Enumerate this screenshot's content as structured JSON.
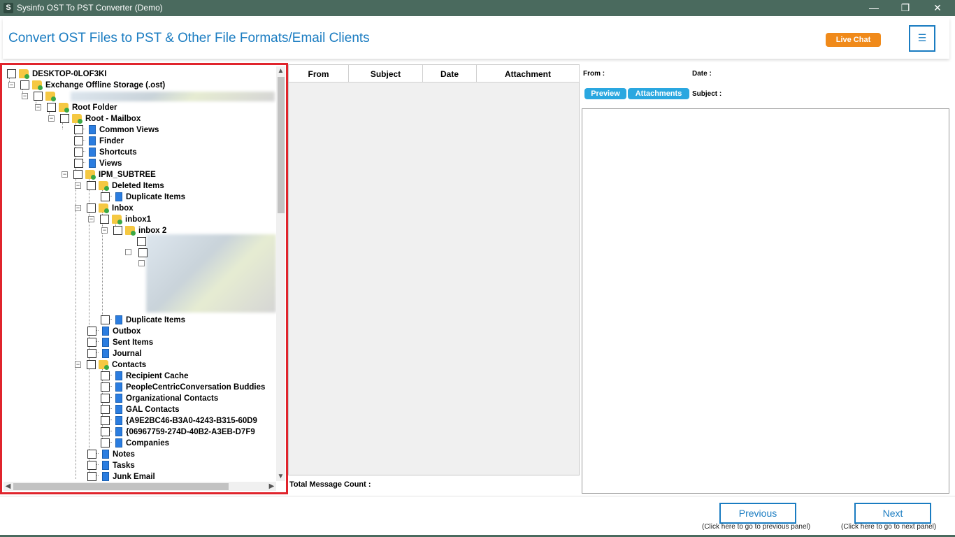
{
  "window": {
    "app_icon_letter": "S",
    "title": "Sysinfo OST To PST Converter (Demo)",
    "minimize": "—",
    "restore": "❐",
    "close": "✕"
  },
  "header": {
    "title": "Convert OST Files to PST & Other File Formats/Email Clients",
    "live_chat": "Live Chat",
    "menu_icon": "☰"
  },
  "tree": {
    "expander": "−",
    "nodes": [
      {
        "label": "DESKTOP-0LOF3KI",
        "icon": "folder-icon"
      },
      {
        "label": "Exchange Offline Storage (.ost)",
        "icon": "folder-icon"
      },
      {
        "label": "",
        "icon": "folder-icon"
      },
      {
        "label": "Root Folder",
        "icon": "folder-icon"
      },
      {
        "label": "Root - Mailbox",
        "icon": "folder-icon"
      },
      {
        "label": "Common Views",
        "icon": "doc-icon"
      },
      {
        "label": "Finder",
        "icon": "doc-icon"
      },
      {
        "label": "Shortcuts",
        "icon": "doc-icon"
      },
      {
        "label": "Views",
        "icon": "doc-icon"
      },
      {
        "label": "IPM_SUBTREE",
        "icon": "folder-icon"
      },
      {
        "label": "Deleted Items",
        "icon": "folder-icon"
      },
      {
        "label": "Duplicate Items",
        "icon": "doc-icon"
      },
      {
        "label": "Inbox",
        "icon": "folder-icon"
      },
      {
        "label": "inbox1",
        "icon": "folder-icon"
      },
      {
        "label": "inbox 2",
        "icon": "folder-icon"
      },
      {
        "label": "Duplicate Items",
        "icon": "doc-icon"
      },
      {
        "label": "Outbox",
        "icon": "doc-icon"
      },
      {
        "label": "Sent Items",
        "icon": "doc-icon"
      },
      {
        "label": "Journal",
        "icon": "doc-icon"
      },
      {
        "label": "Contacts",
        "icon": "folder-icon"
      },
      {
        "label": "Recipient Cache",
        "icon": "doc-icon"
      },
      {
        "label": "PeopleCentricConversation Buddies",
        "icon": "doc-icon"
      },
      {
        "label": "Organizational Contacts",
        "icon": "doc-icon"
      },
      {
        "label": "GAL Contacts",
        "icon": "doc-icon"
      },
      {
        "label": "{A9E2BC46-B3A0-4243-B315-60D9",
        "icon": "doc-icon"
      },
      {
        "label": "{06967759-274D-40B2-A3EB-D7F9",
        "icon": "doc-icon"
      },
      {
        "label": "Companies",
        "icon": "doc-icon"
      },
      {
        "label": "Notes",
        "icon": "doc-icon"
      },
      {
        "label": "Tasks",
        "icon": "doc-icon"
      },
      {
        "label": "Junk Email",
        "icon": "doc-icon"
      }
    ],
    "scroll_up": "▲",
    "scroll_down": "▼",
    "scroll_left": "◀",
    "scroll_right": "▶"
  },
  "message_list": {
    "columns": [
      "From",
      "Subject",
      "Date",
      "Attachment"
    ],
    "total_label": "Total Message Count :"
  },
  "preview_pane": {
    "from_label": "From :",
    "date_label": "Date :",
    "subject_label": "Subject :",
    "tab_preview": "Preview",
    "tab_attachments": "Attachments"
  },
  "footer": {
    "previous_label": "Previous",
    "previous_hint": "(Click here to go to previous panel)",
    "next_label": "Next",
    "next_hint": "(Click here to go to next panel)"
  },
  "colors": {
    "titlebar": "#4a6a5e",
    "accent": "#1a7cc1",
    "live_chat": "#f08a1a",
    "highlight_border": "#e0242c",
    "tab": "#2aa7e0"
  }
}
